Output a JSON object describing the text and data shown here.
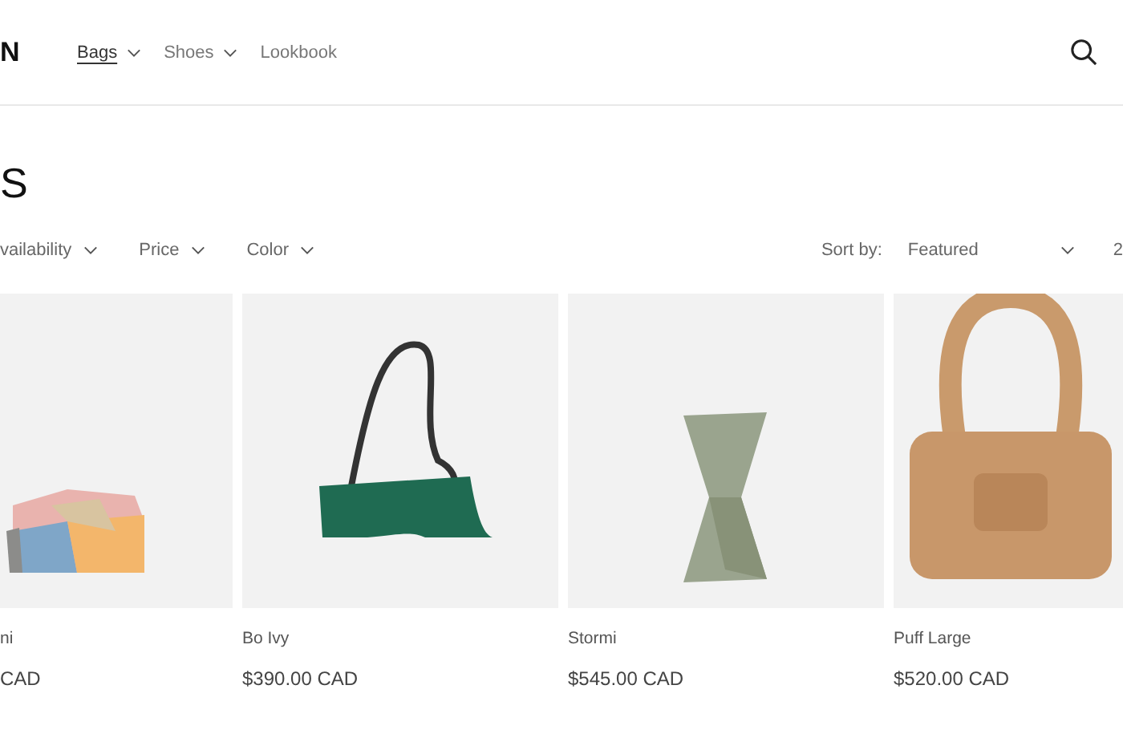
{
  "header": {
    "logo": "N",
    "nav": [
      {
        "label": "Bags",
        "selected": true,
        "dropdown": true
      },
      {
        "label": "Shoes",
        "selected": false,
        "dropdown": true
      },
      {
        "label": "Lookbook",
        "selected": false,
        "dropdown": false
      }
    ]
  },
  "page_title": "S",
  "filters": [
    "vailability",
    "Price",
    "Color"
  ],
  "sort": {
    "label": "Sort by:",
    "value": "Featured",
    "count": "2"
  },
  "products": [
    {
      "kind": "block-bag",
      "name": "ni",
      "price": "CAD"
    },
    {
      "kind": "shoulder-bag",
      "name": "Bo Ivy",
      "price": "$390.00 CAD"
    },
    {
      "kind": "twist-bag",
      "name": "Stormi",
      "price": "$545.00 CAD"
    },
    {
      "kind": "puffy-bag",
      "name": "Puff Large",
      "price": "$520.00 CAD"
    }
  ]
}
